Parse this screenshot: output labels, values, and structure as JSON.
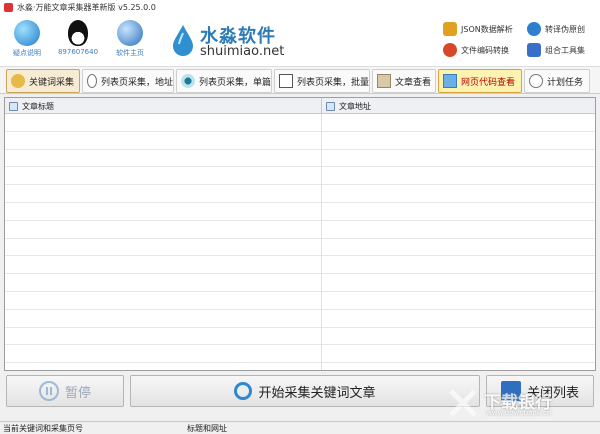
{
  "window": {
    "title": "水淼·万能文章采集器革新版 v5.25.0.0"
  },
  "header": {
    "icons": [
      {
        "label": "疑点说明",
        "icon": "question-globe-icon"
      },
      {
        "label": "897607640",
        "icon": "qq-penguin-icon"
      },
      {
        "label": "软件主页",
        "icon": "home-globe-icon"
      }
    ],
    "brand": {
      "name": "水淼软件",
      "domain": "shuimiao.net"
    },
    "links": [
      {
        "label": "JSON数据解析",
        "icon": "json-icon",
        "color": "#e0a020"
      },
      {
        "label": "转译伪原创",
        "icon": "translate-icon",
        "color": "#2f7fd1"
      },
      {
        "label": "文件编码转换",
        "icon": "file-encode-icon",
        "color": "#d9472b"
      },
      {
        "label": "组合工具集",
        "icon": "toolbox-icon",
        "color": "#3a6fc9"
      }
    ]
  },
  "tabs": [
    {
      "label": "关键词采集",
      "icon": "key-icon",
      "state": "active"
    },
    {
      "label": "列表页采集，地址",
      "icon": "list-link-icon",
      "state": "normal"
    },
    {
      "label": "列表页采集，单篇",
      "icon": "list-eye-icon",
      "state": "normal"
    },
    {
      "label": "列表页采集，批量",
      "icon": "list-batch-icon",
      "state": "normal"
    },
    {
      "label": "文章查看",
      "icon": "article-box-icon",
      "state": "normal"
    },
    {
      "label": "网页代码查看",
      "icon": "code-view-icon",
      "state": "hover"
    },
    {
      "label": "计划任务",
      "icon": "clock-icon",
      "state": "normal"
    }
  ],
  "table": {
    "columns": [
      "文章标题",
      "文章地址"
    ],
    "rows": []
  },
  "buttons": {
    "pause": "暂停",
    "start": "开始采集关键词文章",
    "close_list": "关闭列表"
  },
  "statusbar": {
    "left": "当前关键词和采集页号",
    "right": "标题和网址"
  },
  "watermark": {
    "text": "下载银行",
    "url": "www.downbank.cn"
  },
  "colors": {
    "accent": "#2c7bb6",
    "active_tab": "#f7ecd3",
    "hover_tab": "#fdf3b0"
  }
}
